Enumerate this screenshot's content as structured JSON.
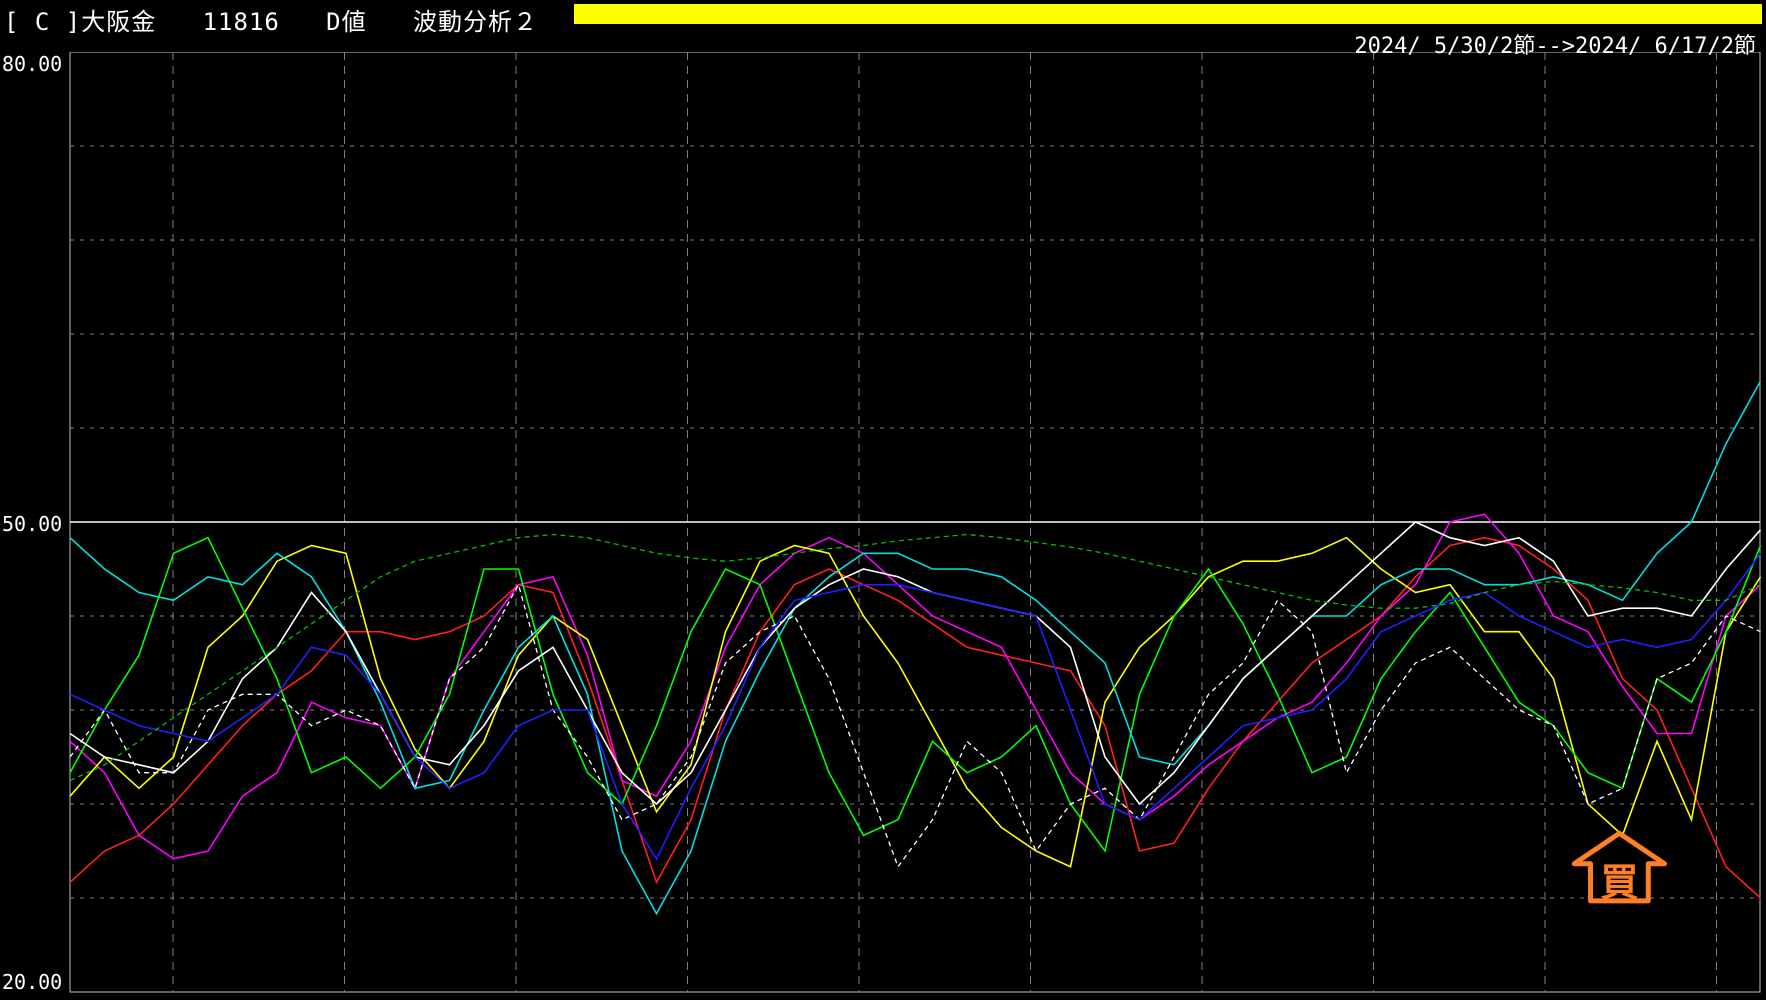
{
  "header": {
    "title": "[ C ]大阪金   11816   D値   波動分析２",
    "date_range": "2024/ 5/30/2節-->2024/ 6/17/2節",
    "bar_color": "#ffff00"
  },
  "signal": {
    "label": "買",
    "color": "#ff7f27"
  },
  "chart_data": {
    "type": "line",
    "ylim": [
      20,
      80
    ],
    "yticks": [
      "80.00",
      "50.00",
      "20.00"
    ],
    "xlim": [
      0,
      49
    ],
    "reference_line": 50,
    "grid": true,
    "background": "#000000",
    "series": [
      {
        "color": "#ff2020",
        "dashed": false,
        "values": [
          27,
          29,
          30,
          32,
          34.5,
          37,
          39,
          40.5,
          43,
          43,
          42.5,
          43,
          44,
          46,
          45.5,
          40,
          33.5,
          27,
          31,
          38,
          43,
          46,
          47,
          46,
          45,
          43.5,
          42,
          41.5,
          41,
          40.5,
          37,
          29,
          29.5,
          33,
          36,
          38.5,
          41,
          42.5,
          44,
          46.5,
          48.5,
          49,
          48.5,
          47,
          45,
          40,
          38,
          33,
          28,
          26
        ]
      },
      {
        "color": "#ff00ff",
        "dashed": false,
        "values": [
          36,
          34,
          30,
          28.5,
          29,
          32.5,
          34,
          38.5,
          37.5,
          37,
          33,
          40,
          43,
          46,
          46.5,
          41.5,
          33.5,
          32.5,
          36,
          42,
          46,
          48,
          49,
          48,
          46,
          44,
          43,
          42,
          38,
          34,
          32,
          31,
          32.5,
          34.5,
          36,
          37.5,
          38.5,
          41,
          44,
          46,
          50,
          50.5,
          48,
          44,
          43,
          39.5,
          36.5,
          36.5,
          44,
          46
        ]
      },
      {
        "color": "#ffff00",
        "dashed": false,
        "values": [
          32.5,
          35,
          33,
          35,
          42,
          44,
          47.5,
          48.5,
          48,
          40,
          35.5,
          33,
          36,
          41.5,
          44,
          42.5,
          37,
          31.5,
          34.5,
          43,
          47.5,
          48.5,
          48,
          44,
          41,
          37,
          33,
          30.5,
          29,
          28,
          38.5,
          42,
          44,
          46.5,
          47.5,
          47.5,
          48,
          49,
          47,
          45.5,
          46,
          43,
          43,
          40,
          32,
          30,
          36,
          31,
          43,
          46.5
        ]
      },
      {
        "color": "#00ff00",
        "dashed": false,
        "values": [
          34,
          38,
          41.5,
          48,
          49,
          44.5,
          40,
          34,
          35,
          33,
          35,
          39,
          47,
          47,
          39,
          34,
          32,
          37,
          43,
          47,
          46,
          40,
          34,
          30,
          31,
          36,
          34,
          35,
          37,
          32,
          29,
          39,
          44,
          47,
          43.5,
          39,
          34,
          35,
          40,
          43,
          45.5,
          42,
          38.5,
          37,
          34,
          33,
          40,
          38.5,
          43,
          48.5
        ]
      },
      {
        "color": "#00e0e0",
        "dashed": false,
        "values": [
          49,
          47,
          45.5,
          45,
          46.5,
          46,
          48,
          46.5,
          43,
          38.5,
          33,
          33.5,
          38,
          42,
          44,
          39,
          29,
          25,
          29,
          36,
          40.5,
          44.5,
          46.5,
          48,
          48,
          47,
          47,
          46.5,
          45,
          43,
          41,
          35,
          34.5,
          37,
          40,
          42,
          44,
          44,
          46,
          47,
          47,
          46,
          46,
          46.5,
          46,
          45,
          48,
          50,
          55,
          59
        ]
      },
      {
        "color": "#ffffff",
        "dashed": false,
        "values": [
          36.5,
          35,
          34.5,
          34,
          36,
          40,
          42,
          45.5,
          43,
          39,
          35,
          34.5,
          37,
          40.5,
          42,
          38,
          34,
          32,
          34,
          38,
          42,
          44.5,
          46,
          47,
          46.5,
          45.5,
          45,
          44.5,
          44,
          42,
          35,
          32,
          34,
          37,
          40,
          42,
          44,
          46,
          48,
          50,
          49,
          48.5,
          49,
          47.5,
          44,
          44.5,
          44.5,
          44,
          47,
          49.5
        ]
      },
      {
        "color": "#ffffff",
        "dashed": true,
        "values": [
          35,
          38,
          34,
          34,
          38,
          39,
          39,
          37,
          38,
          37,
          33,
          40,
          42,
          46,
          38,
          35,
          31,
          32,
          35,
          41,
          43,
          44,
          40,
          34,
          28,
          31,
          36,
          34,
          29,
          32,
          33,
          31,
          35,
          39,
          41,
          45,
          43,
          34,
          38,
          41,
          42,
          40,
          38,
          37,
          32,
          33,
          40,
          41,
          44,
          43
        ]
      },
      {
        "color": "#2020ff",
        "dashed": false,
        "values": [
          39,
          38,
          37,
          36.5,
          36,
          37.5,
          39,
          42,
          41.5,
          39,
          35,
          33,
          34,
          37,
          38,
          38,
          32,
          28.5,
          33,
          37,
          42,
          45,
          45.5,
          46,
          46,
          45.5,
          45,
          44.5,
          44,
          38,
          32,
          31,
          33,
          35,
          37,
          37.5,
          38,
          40,
          43,
          44,
          45,
          45.5,
          44,
          43,
          42,
          42.5,
          42,
          42.5,
          45,
          48
        ]
      },
      {
        "color": "#00c000",
        "dashed": true,
        "values": [
          33.5,
          34.5,
          36,
          37.5,
          39,
          40.5,
          42,
          43.5,
          45,
          46.5,
          47.5,
          48,
          48.5,
          49,
          49.2,
          49,
          48.5,
          48,
          47.7,
          47.5,
          47.7,
          48,
          48.3,
          48.5,
          48.8,
          49,
          49.2,
          49,
          48.7,
          48.4,
          48,
          47.5,
          47,
          46.5,
          46,
          45.5,
          45,
          44.7,
          44.5,
          44.5,
          44.8,
          45.5,
          46,
          46.2,
          46,
          45.8,
          45.5,
          45,
          45,
          46
        ]
      }
    ]
  }
}
